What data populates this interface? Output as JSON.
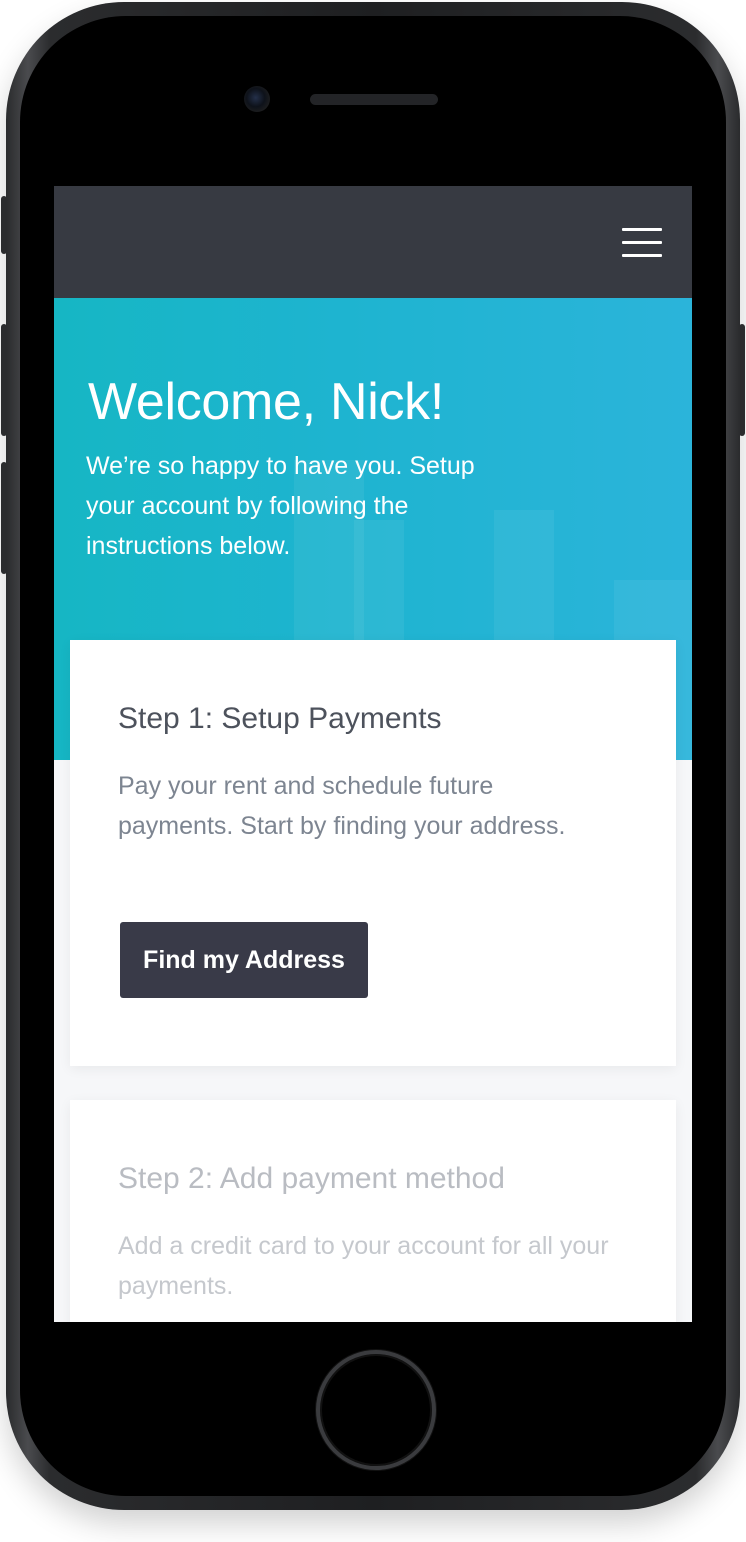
{
  "hero": {
    "title": "Welcome, Nick!",
    "subtitle": "We’re so happy to have you. Setup your account by following the instructions below."
  },
  "steps": [
    {
      "title": "Step 1: Setup Payments",
      "description": "Pay your rent and schedule future payments. Start by finding your address.",
      "button_label": "Find my Address"
    },
    {
      "title": "Step 2: Add payment method",
      "description": "Add a credit card to your account for all your payments."
    }
  ],
  "icons": {
    "menu": "hamburger-menu-icon"
  },
  "colors": {
    "topbar": "#373a42",
    "hero_gradient_start": "#16b6c4",
    "hero_gradient_end": "#2bb4da",
    "button": "#393a48",
    "card_title": "#4d525c",
    "card_text": "#7d8591",
    "disabled_text": "#c5c8cd"
  }
}
